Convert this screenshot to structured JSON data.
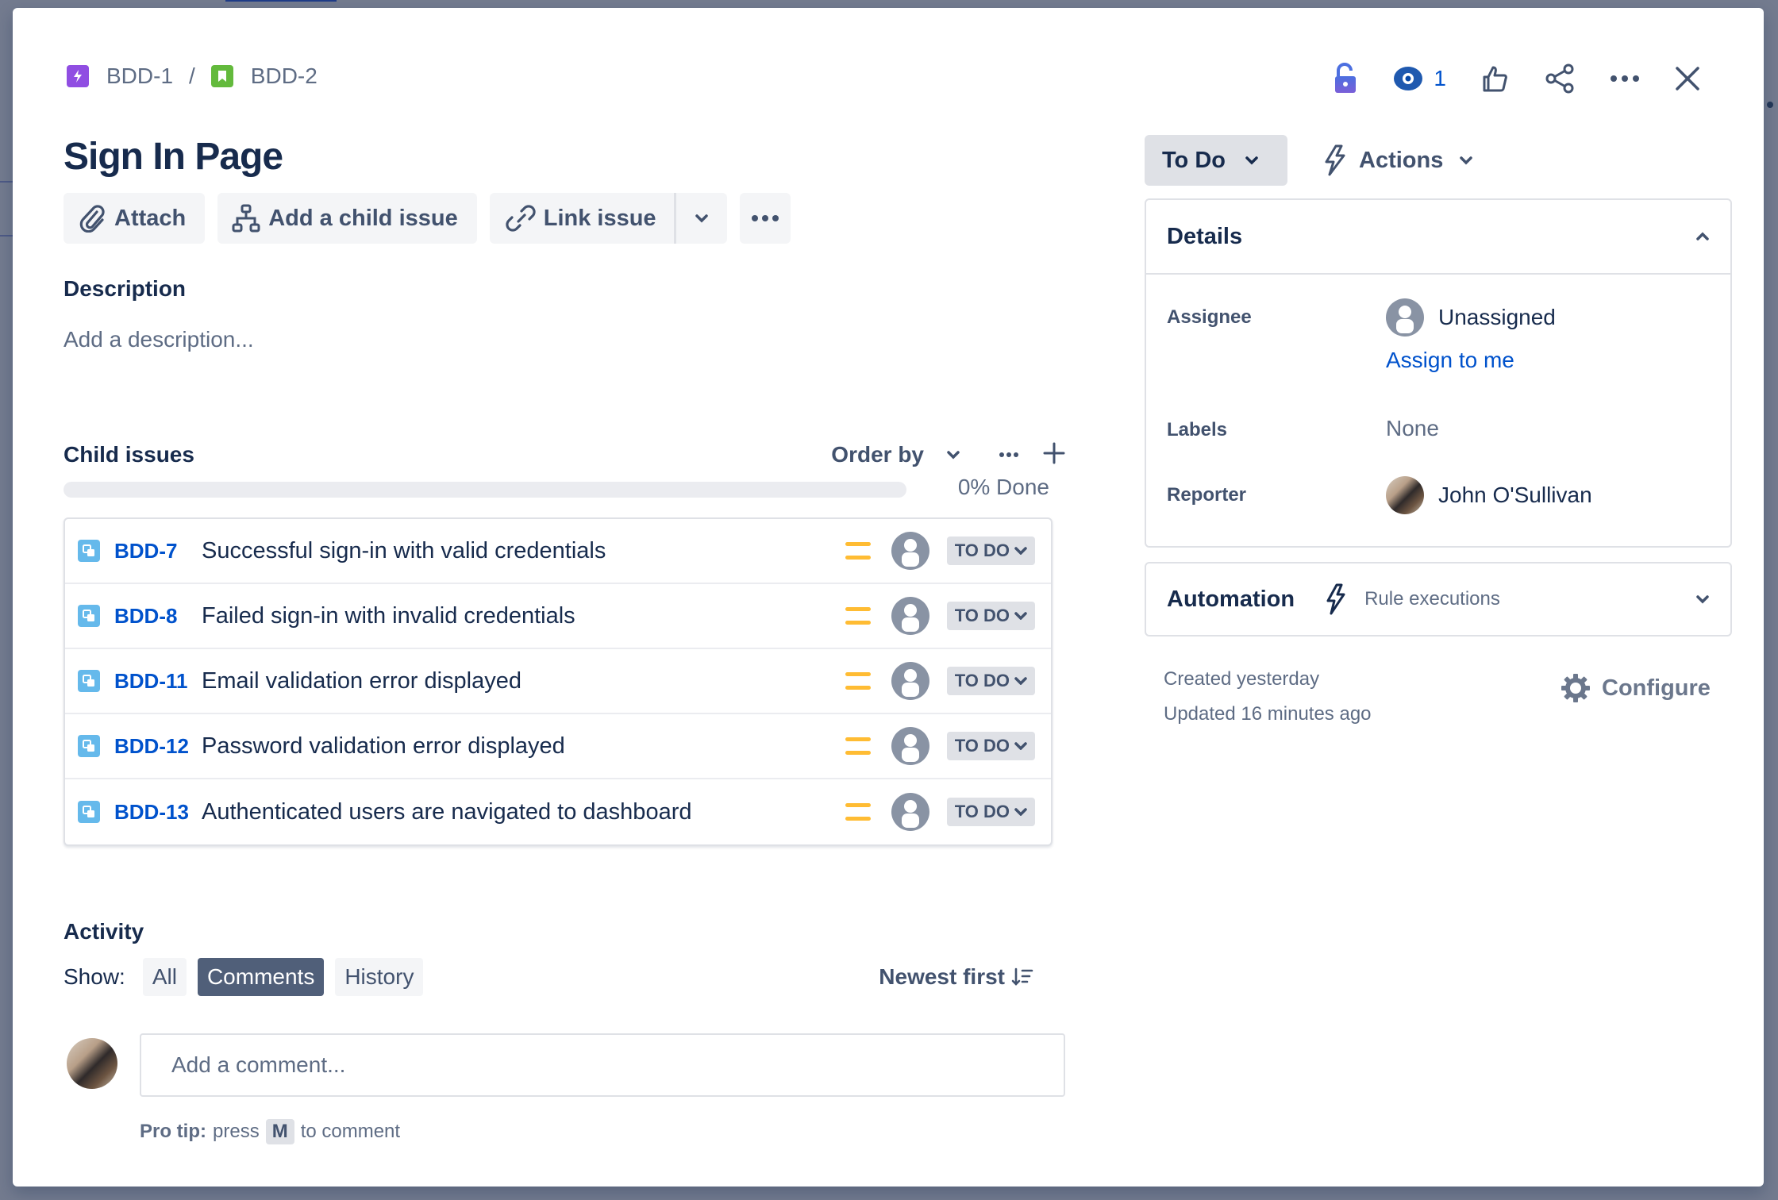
{
  "breadcrumb": [
    {
      "key": "BDD-1",
      "type": "epic-icon"
    },
    {
      "key": "BDD-2",
      "type": "story-icon"
    }
  ],
  "breadcrumb_separator": "/",
  "header_actions": {
    "watch_count": "1",
    "icons": [
      "lock-open-icon",
      "eye-icon",
      "thumbs-up-icon",
      "share-icon",
      "more-icon",
      "close-icon"
    ]
  },
  "issue": {
    "title": "Sign In Page"
  },
  "toolbar": {
    "attach_label": "Attach",
    "add_child_label": "Add a child issue",
    "link_issue_label": "Link issue"
  },
  "description": {
    "label": "Description",
    "placeholder": "Add a description..."
  },
  "child_issues": {
    "label": "Child issues",
    "order_by_label": "Order by",
    "progress_percent": 0,
    "progress_label": "0% Done",
    "items": [
      {
        "key": "BDD-7",
        "summary": "Successful sign-in with valid credentials",
        "priority": "Medium",
        "status": "TO DO"
      },
      {
        "key": "BDD-8",
        "summary": "Failed sign-in with invalid credentials",
        "priority": "Medium",
        "status": "TO DO"
      },
      {
        "key": "BDD-11",
        "summary": "Email validation error displayed",
        "priority": "Medium",
        "status": "TO DO"
      },
      {
        "key": "BDD-12",
        "summary": "Password validation error displayed",
        "priority": "Medium",
        "status": "TO DO"
      },
      {
        "key": "BDD-13",
        "summary": "Authenticated users are navigated to dashboard",
        "priority": "Medium",
        "status": "TO DO"
      }
    ]
  },
  "activity": {
    "label": "Activity",
    "show_label": "Show:",
    "filters": [
      {
        "label": "All",
        "active": false
      },
      {
        "label": "Comments",
        "active": true
      },
      {
        "label": "History",
        "active": false
      }
    ],
    "sort_label": "Newest first",
    "comment_placeholder": "Add a comment...",
    "pro_tip_bold": "Pro tip:",
    "pro_tip_pre": "press",
    "pro_tip_key": "M",
    "pro_tip_post": "to comment"
  },
  "sidebar": {
    "status_label": "To Do",
    "actions_label": "Actions",
    "details": {
      "title": "Details",
      "assignee_label": "Assignee",
      "assignee_value": "Unassigned",
      "assign_to_me": "Assign to me",
      "labels_label": "Labels",
      "labels_value": "None",
      "reporter_label": "Reporter",
      "reporter_value": "John O'Sullivan"
    },
    "automation": {
      "title": "Automation",
      "rule_label": "Rule executions"
    },
    "created": "Created yesterday",
    "updated": "Updated 16 minutes ago",
    "configure_label": "Configure"
  },
  "colors": {
    "link": "#0052cc",
    "text": "#172b4d",
    "subtle": "#5e6c84",
    "priority_medium": "#ffab00",
    "epic": "#904ee2",
    "story": "#63ba3c",
    "subtask": "#4bade8",
    "active_filter": "#505f79"
  }
}
